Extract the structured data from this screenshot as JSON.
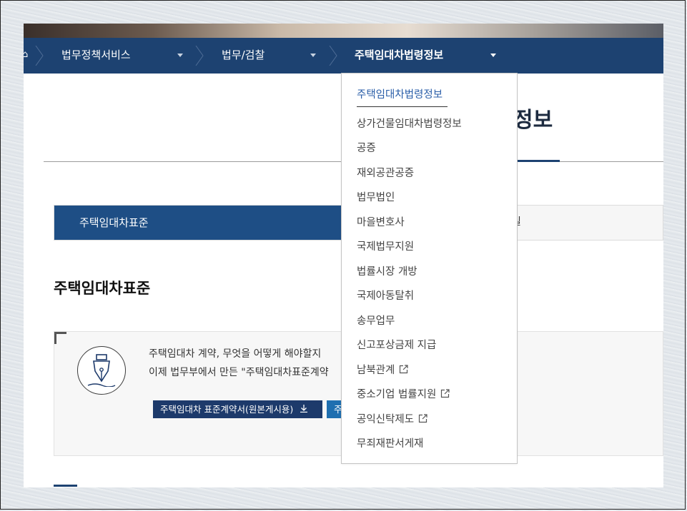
{
  "nav": {
    "crumbs": [
      {
        "label": "법무정책서비스"
      },
      {
        "label": "법무/검찰"
      },
      {
        "label": "주택임대차법령정보"
      }
    ]
  },
  "page": {
    "title_visible": "정보"
  },
  "tabs": {
    "active_label": "주택임대차표준",
    "other_label_tail": "실"
  },
  "section": {
    "heading": "주택임대차표준",
    "info_line1": "주택임대차 계약, 무엇을 어떻게 해야할지",
    "info_line2": "이제 법무부에서 만든 \"주택임대차표준계약",
    "download_primary": "주택임대차 표준계약서(원본게시용)",
    "download_secondary": "주"
  },
  "dropdown": {
    "items": [
      {
        "label": "주택임대차법령정보",
        "selected": true,
        "external": false
      },
      {
        "label": "상가건물임대차법령정보",
        "selected": false,
        "external": false
      },
      {
        "label": "공증",
        "selected": false,
        "external": false
      },
      {
        "label": "재외공관공증",
        "selected": false,
        "external": false
      },
      {
        "label": "법무법인",
        "selected": false,
        "external": false
      },
      {
        "label": "마을변호사",
        "selected": false,
        "external": false
      },
      {
        "label": "국제법무지원",
        "selected": false,
        "external": false
      },
      {
        "label": "법률시장 개방",
        "selected": false,
        "external": false
      },
      {
        "label": "국제아동탈취",
        "selected": false,
        "external": false
      },
      {
        "label": "송무업무",
        "selected": false,
        "external": false
      },
      {
        "label": "신고포상금제 지급",
        "selected": false,
        "external": false
      },
      {
        "label": "남북관계",
        "selected": false,
        "external": true
      },
      {
        "label": "중소기업 법률지원",
        "selected": false,
        "external": true
      },
      {
        "label": "공익신탁제도",
        "selected": false,
        "external": true
      },
      {
        "label": "무죄재판서게재",
        "selected": false,
        "external": false
      }
    ]
  },
  "colors": {
    "nav_bg": "#1d4271",
    "tab_active_bg": "#1e4e85",
    "selected_item": "#2a5ea8"
  },
  "icons": {
    "home": "home-icon",
    "breadcrumb_separator": "chevron-right-icon",
    "caret": "caret-down-icon",
    "pen": "fountain-pen-icon",
    "download": "download-icon",
    "external": "external-link-icon"
  }
}
